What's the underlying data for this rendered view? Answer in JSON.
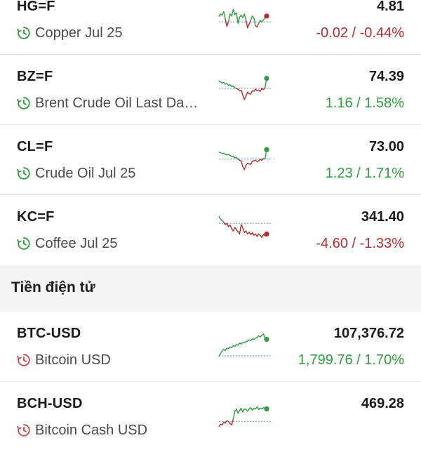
{
  "colors": {
    "up": "#2e9e3e",
    "down": "#b82d2d",
    "clock_green": "#2e9e3e",
    "clock_red": "#cc4a4a",
    "baseline": "#5b93c7"
  },
  "section": {
    "title": "Tiền điện tử"
  },
  "rows": [
    {
      "symbol": "HG=F",
      "name": "Copper Jul 25",
      "price": "4.81",
      "change": "-0.02 / -0.44%",
      "direction": "down",
      "icon": "clock-icon",
      "spark": [
        0.55,
        0.62,
        0.58,
        0.7,
        0.45,
        0.2,
        0.35,
        0.62,
        0.55,
        0.78,
        0.6,
        0.66,
        0.3,
        0.52,
        0.58,
        0.5,
        0.62,
        0.42,
        0.15,
        0.28,
        0.4,
        0.55,
        0.48,
        0.22,
        0.18,
        0.3,
        0.4,
        0.35,
        0.42,
        0.5,
        0.55
      ],
      "baseline": 0.35
    },
    {
      "symbol": "BZ=F",
      "name": "Brent Crude Oil Last Da…",
      "price": "74.39",
      "change": "1.16 / 1.58%",
      "direction": "up",
      "icon": "clock-icon",
      "spark": [
        0.72,
        0.7,
        0.66,
        0.68,
        0.62,
        0.64,
        0.58,
        0.6,
        0.54,
        0.56,
        0.5,
        0.48,
        0.45,
        0.4,
        0.42,
        0.25,
        0.1,
        0.22,
        0.35,
        0.3,
        0.28,
        0.4,
        0.38,
        0.45,
        0.4,
        0.42,
        0.38,
        0.48,
        0.44,
        0.5,
        0.82
      ],
      "baseline": 0.48
    },
    {
      "symbol": "CL=F",
      "name": "Crude Oil Jul 25",
      "price": "73.00",
      "change": "1.23 / 1.71%",
      "direction": "up",
      "icon": "clock-icon",
      "spark": [
        0.7,
        0.68,
        0.65,
        0.66,
        0.62,
        0.6,
        0.62,
        0.58,
        0.55,
        0.56,
        0.5,
        0.52,
        0.46,
        0.42,
        0.4,
        0.2,
        0.1,
        0.25,
        0.32,
        0.3,
        0.28,
        0.38,
        0.4,
        0.42,
        0.38,
        0.4,
        0.45,
        0.42,
        0.48,
        0.46,
        0.78
      ],
      "baseline": 0.46
    },
    {
      "symbol": "KC=F",
      "name": "Coffee Jul 25",
      "price": "341.40",
      "change": "-4.60 / -1.33%",
      "direction": "down",
      "icon": "clock-icon",
      "spark": [
        0.9,
        0.8,
        0.76,
        0.7,
        0.62,
        0.66,
        0.55,
        0.6,
        0.48,
        0.4,
        0.52,
        0.45,
        0.38,
        0.3,
        0.62,
        0.5,
        0.35,
        0.4,
        0.3,
        0.36,
        0.28,
        0.34,
        0.26,
        0.3,
        0.22,
        0.3,
        0.25,
        0.18,
        0.28,
        0.24,
        0.3
      ],
      "baseline": 0.66
    },
    {
      "symbol": "BTC-USD",
      "name": "Bitcoin USD",
      "price": "107,376.72",
      "change": "1,799.76 / 1.70%",
      "direction": "up",
      "icon": "clock-icon",
      "spark": [
        0.1,
        0.2,
        0.28,
        0.34,
        0.3,
        0.38,
        0.36,
        0.42,
        0.4,
        0.46,
        0.44,
        0.5,
        0.48,
        0.55,
        0.52,
        0.58,
        0.56,
        0.6,
        0.62,
        0.66,
        0.64,
        0.7,
        0.68,
        0.72,
        0.74,
        0.8,
        0.76,
        0.82,
        0.86,
        0.72,
        0.68
      ],
      "baseline": 0.12
    },
    {
      "symbol": "BCH-USD",
      "name": "Bitcoin Cash USD",
      "price": "469.28",
      "change": "",
      "direction": "up",
      "icon": "clock-icon",
      "spark": [
        0.1,
        0.18,
        0.15,
        0.25,
        0.22,
        0.3,
        0.28,
        0.2,
        0.16,
        0.35,
        0.62,
        0.7,
        0.55,
        0.65,
        0.72,
        0.6,
        0.7,
        0.68,
        0.62,
        0.7,
        0.74,
        0.66,
        0.72,
        0.7,
        0.76,
        0.68,
        0.72,
        0.7,
        0.74,
        0.72,
        0.7
      ],
      "baseline": 0.28
    }
  ]
}
